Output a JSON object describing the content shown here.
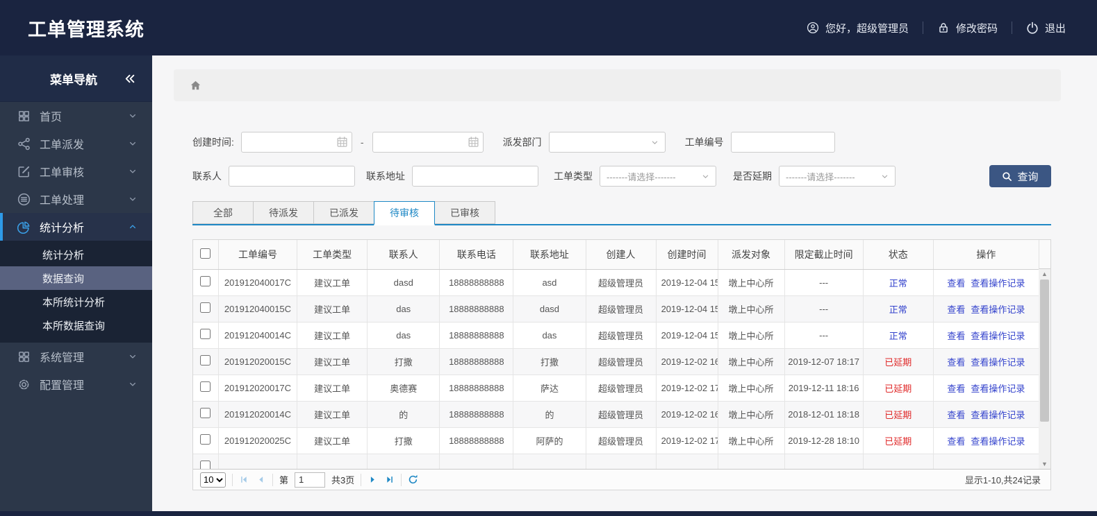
{
  "app": {
    "title": "工单管理系统"
  },
  "header": {
    "greeting": "您好，超级管理员",
    "change_password": "修改密码",
    "logout": "退出"
  },
  "sidebar": {
    "title": "菜单导航",
    "items": [
      {
        "label": "首页",
        "icon": "dashboard-icon"
      },
      {
        "label": "工单派发",
        "icon": "share-icon"
      },
      {
        "label": "工单审核",
        "icon": "edit-icon"
      },
      {
        "label": "工单处理",
        "icon": "process-icon"
      },
      {
        "label": "统计分析",
        "icon": "pie-chart-icon",
        "active": true,
        "expanded": true,
        "children": [
          {
            "label": "统计分析"
          },
          {
            "label": "数据查询",
            "selected": true
          },
          {
            "label": "本所统计分析"
          },
          {
            "label": "本所数据查询"
          }
        ]
      },
      {
        "label": "系统管理",
        "icon": "modules-icon"
      },
      {
        "label": "配置管理",
        "icon": "gear-icon"
      }
    ]
  },
  "filters": {
    "created_label": "创建时间:",
    "range_sep": "-",
    "dept_label": "派发部门",
    "orderno_label": "工单编号",
    "contact_label": "联系人",
    "address_label": "联系地址",
    "type_label": "工单类型",
    "delay_label": "是否延期",
    "select_placeholder": "-------请选择-------",
    "search_label": "查询"
  },
  "tabs": [
    {
      "label": "全部"
    },
    {
      "label": "待派发"
    },
    {
      "label": "已派发"
    },
    {
      "label": "待审核",
      "active": true
    },
    {
      "label": "已审核"
    }
  ],
  "table": {
    "columns": [
      "工单编号",
      "工单类型",
      "联系人",
      "联系电话",
      "联系地址",
      "创建人",
      "创建时间",
      "派发对象",
      "限定截止时间",
      "状态",
      "操作"
    ],
    "action_labels": [
      "查看",
      "查看操作记录"
    ],
    "status_delayed_value": "已延期",
    "rows": [
      {
        "order_no": "201912040017C",
        "type": "建议工单",
        "contact": "dasd",
        "phone": "18888888888",
        "address": "asd",
        "creator": "超级管理员",
        "created": "2019-12-04 15",
        "target": "墩上中心所",
        "deadline": "---",
        "status": "正常"
      },
      {
        "order_no": "201912040015C",
        "type": "建议工单",
        "contact": "das",
        "phone": "18888888888",
        "address": "dasd",
        "creator": "超级管理员",
        "created": "2019-12-04 15",
        "target": "墩上中心所",
        "deadline": "---",
        "status": "正常"
      },
      {
        "order_no": "201912040014C",
        "type": "建议工单",
        "contact": "das",
        "phone": "18888888888",
        "address": "das",
        "creator": "超级管理员",
        "created": "2019-12-04 15",
        "target": "墩上中心所",
        "deadline": "---",
        "status": "正常"
      },
      {
        "order_no": "201912020015C",
        "type": "建议工单",
        "contact": "打撒",
        "phone": "18888888888",
        "address": "打撒",
        "creator": "超级管理员",
        "created": "2019-12-02 16",
        "target": "墩上中心所",
        "deadline": "2019-12-07 18:17",
        "status": "已延期"
      },
      {
        "order_no": "201912020017C",
        "type": "建议工单",
        "contact": "奥德赛",
        "phone": "18888888888",
        "address": "萨达",
        "creator": "超级管理员",
        "created": "2019-12-02 17",
        "target": "墩上中心所",
        "deadline": "2019-12-11 18:16",
        "status": "已延期"
      },
      {
        "order_no": "201912020014C",
        "type": "建议工单",
        "contact": "的",
        "phone": "18888888888",
        "address": "的",
        "creator": "超级管理员",
        "created": "2019-12-02 16",
        "target": "墩上中心所",
        "deadline": "2018-12-01 18:18",
        "status": "已延期"
      },
      {
        "order_no": "201912020025C",
        "type": "建议工单",
        "contact": "打撒",
        "phone": "18888888888",
        "address": "阿萨的",
        "creator": "超级管理员",
        "created": "2019-12-02 17",
        "target": "墩上中心所",
        "deadline": "2019-12-28 18:10",
        "status": "已延期"
      }
    ]
  },
  "pagination": {
    "page_size": "10",
    "page_size_options": [
      "10"
    ],
    "page_prefix": "第",
    "current_page": "1",
    "total_pages": "共3页",
    "summary": "显示1-10,共24记录"
  },
  "colors": {
    "header_bg": "#1a2440",
    "sidebar_bg": "#2c3749",
    "accent_blue": "#1e88c5",
    "sidebar_active_blue": "#2e9ae8",
    "link_blue": "#3342cc",
    "status_normal": "#3342cc",
    "status_delayed": "#e02a2a",
    "search_button_bg": "#3b5683"
  }
}
